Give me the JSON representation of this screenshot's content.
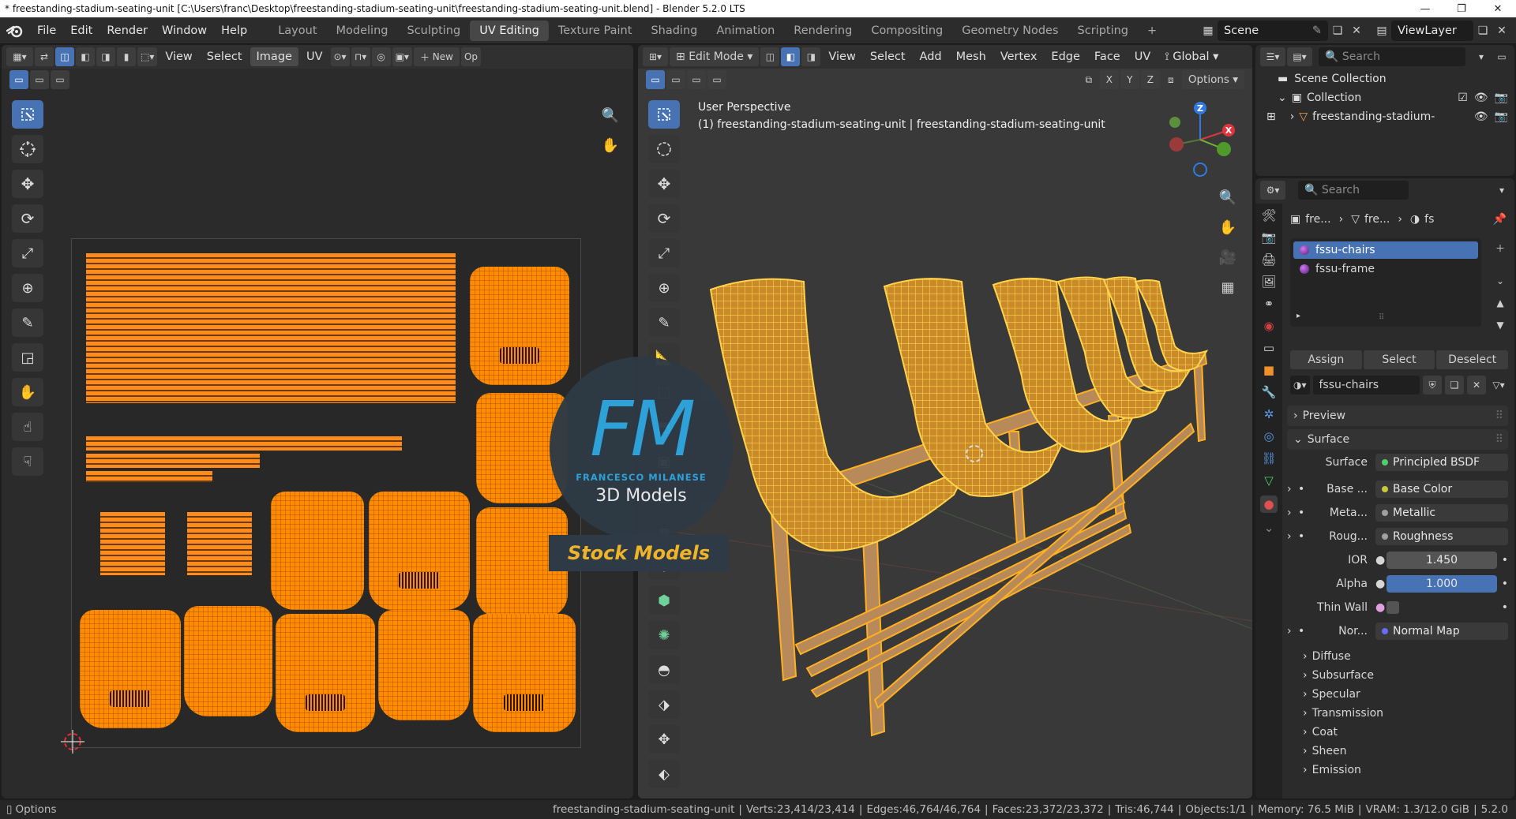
{
  "window": {
    "title": "* freestanding-stadium-seating-unit [C:\\Users\\franc\\Desktop\\freestanding-stadium-seating-unit\\freestanding-stadium-seating-unit.blend] - Blender 5.2.0 LTS",
    "minimize": "—",
    "maximize": "❐",
    "close": "✕"
  },
  "menu": [
    "File",
    "Edit",
    "Render",
    "Window",
    "Help"
  ],
  "workspaces": [
    "Layout",
    "Modeling",
    "Sculpting",
    "UV Editing",
    "Texture Paint",
    "Shading",
    "Animation",
    "Rendering",
    "Compositing",
    "Geometry Nodes",
    "Scripting"
  ],
  "active_workspace": "UV Editing",
  "add_workspace": "+",
  "scene": "Scene",
  "view_layer": "ViewLayer",
  "uv_editor": {
    "menus": [
      "View",
      "Select",
      "Image",
      "UV"
    ],
    "new_button": "New",
    "open_button": "Op"
  },
  "viewport": {
    "mode": "Edit Mode",
    "menus": [
      "View",
      "Select",
      "Add",
      "Mesh",
      "Vertex",
      "Edge",
      "Face",
      "UV"
    ],
    "transform_orientation": "Global",
    "axis_x": "X",
    "axis_y": "Y",
    "axis_z": "Z",
    "options": "Options",
    "view_name": "User Perspective",
    "object_info": "(1) freestanding-stadium-seating-unit | freestanding-stadium-seating-unit",
    "gizmo_x": "X",
    "gizmo_y": "Y",
    "gizmo_z": "Z"
  },
  "outliner": {
    "search_placeholder": "Search",
    "scene_collection": "Scene Collection",
    "collection": "Collection",
    "object": "freestanding-stadium-"
  },
  "properties": {
    "search_placeholder": "Search",
    "breadcrumb": [
      "fre...",
      "fre...",
      "fs"
    ],
    "materials": [
      "fssu-chairs",
      "fssu-frame"
    ],
    "assign": "Assign",
    "select": "Select",
    "deselect": "Deselect",
    "material_name": "fssu-chairs",
    "panels": {
      "preview": "Preview",
      "surface": "Surface"
    },
    "surface_label": "Surface",
    "surface_value": "Principled BSDF",
    "rows": [
      {
        "label": "Base ...",
        "value": "Base Color",
        "dot": "#c8c83c"
      },
      {
        "label": "Meta...",
        "value": "Metallic",
        "dot": "#a0a0a0"
      },
      {
        "label": "Roug...",
        "value": "Roughness",
        "dot": "#a0a0a0"
      }
    ],
    "ior_label": "IOR",
    "ior_value": "1.450",
    "alpha_label": "Alpha",
    "alpha_value": "1.000",
    "thin_wall_label": "Thin Wall",
    "normal_label": "Nor...",
    "normal_value": "Normal Map",
    "subpanels": [
      "Diffuse",
      "Subsurface",
      "Specular",
      "Transmission",
      "Coat",
      "Sheen",
      "Emission"
    ]
  },
  "watermark": {
    "logo_letters": "FM",
    "brand": "FRANCESCO MILANESE",
    "tagline": "3D Models",
    "banner": "Stock Models"
  },
  "statusbar": {
    "left": "Options",
    "object": "freestanding-stadium-seating-unit",
    "verts": "Verts:23,414/23,414",
    "edges": "Edges:46,764/46,764",
    "faces": "Faces:23,372/23,372",
    "tris": "Tris:46,744",
    "objects": "Objects:1/1",
    "memory": "Memory: 76.5 MiB",
    "vram": "VRAM: 1.3/12.0 GiB",
    "version": "5.2.0"
  },
  "colors": {
    "accent_blue": "#4772b3",
    "uv_orange": "#ff8c00",
    "mesh_yellow": "#ffc933",
    "background": "#1d1d1d"
  }
}
